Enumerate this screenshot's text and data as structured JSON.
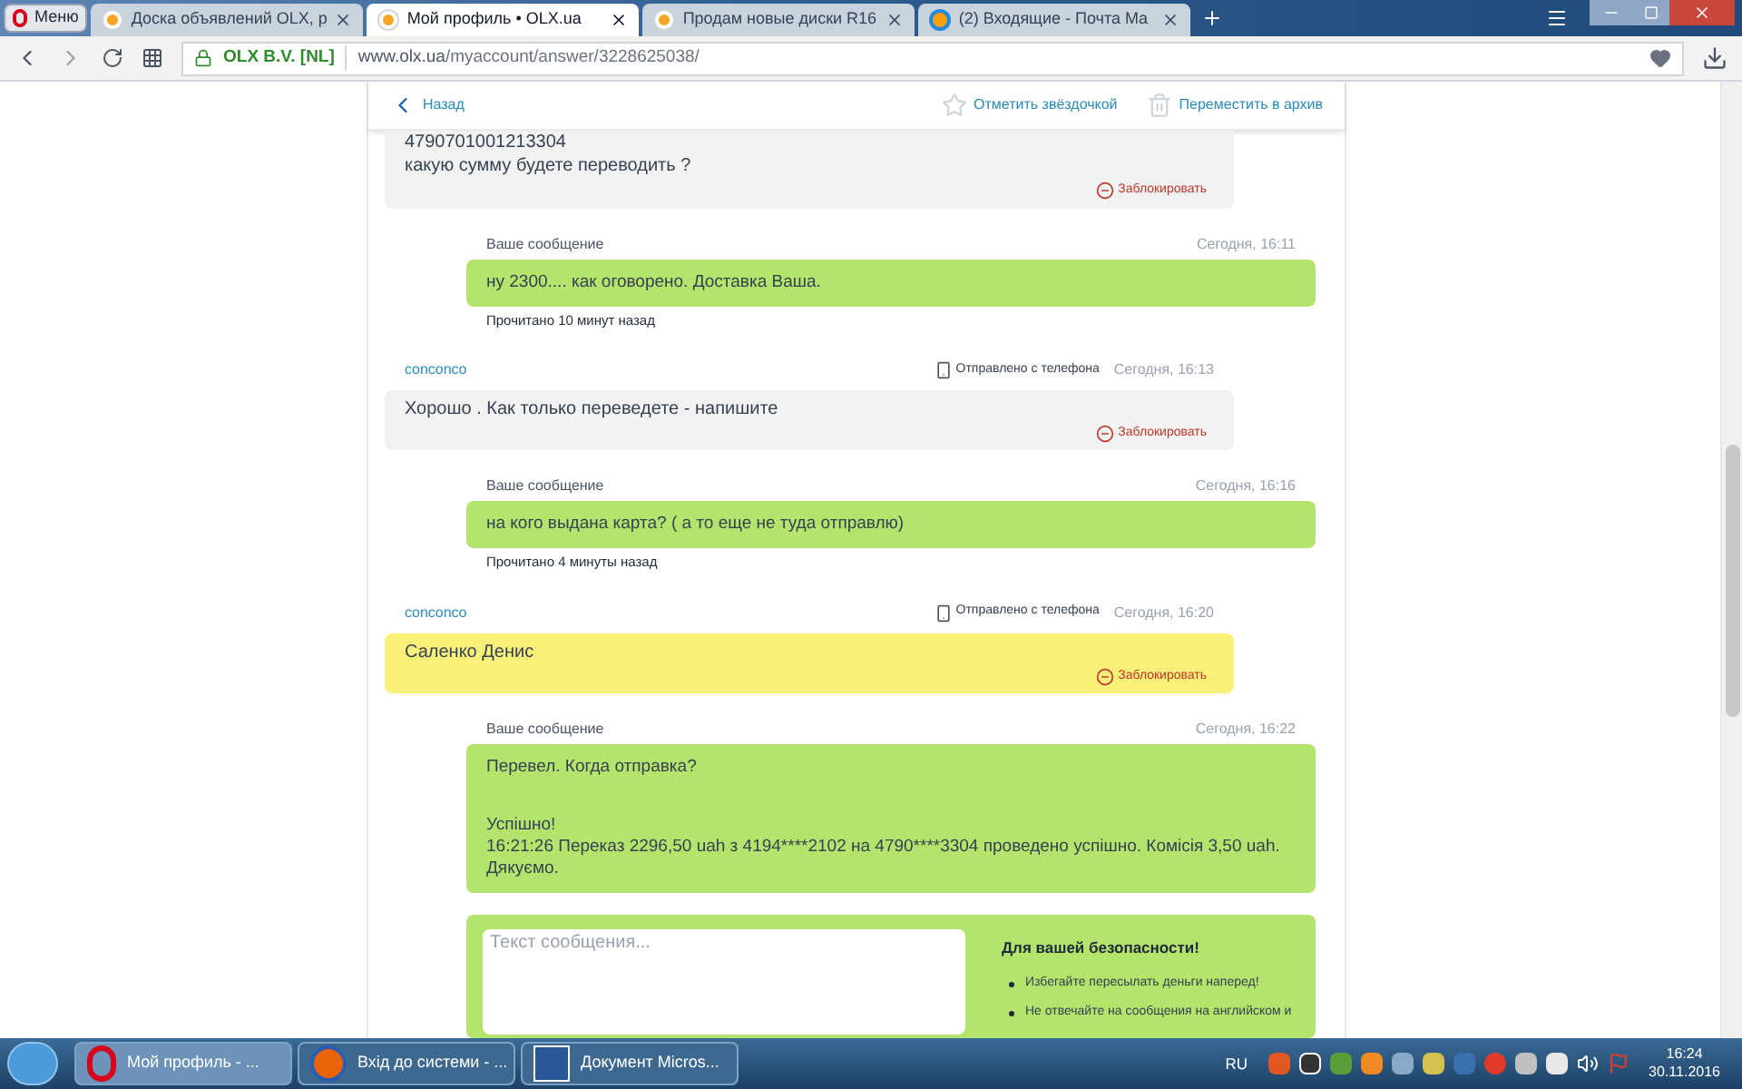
{
  "browser": {
    "menu_label": "Меню",
    "tabs": [
      {
        "title": "Доска объявлений OLX, р",
        "selected": false,
        "kind": "olx"
      },
      {
        "title": "Мой профиль • OLX.ua",
        "selected": true,
        "kind": "olx"
      },
      {
        "title": "Продам новые диски R16",
        "selected": false,
        "kind": "olx"
      },
      {
        "title": "(2) Входящие - Почта Ma",
        "selected": false,
        "kind": "mail"
      }
    ],
    "address": {
      "security": "OLX B.V. [NL]",
      "host": "www.olx.ua",
      "path": "/myaccount/answer/3228625038/"
    }
  },
  "toolbar": {
    "back": "Назад",
    "star": "Отметить звёздочкой",
    "archive": "Переместить в архив"
  },
  "messages": [
    {
      "kind": "incoming",
      "lines": [
        "4790701001213304\nкакую сумму будете переводить ?"
      ],
      "block": "Заблокировать",
      "highlighted": false
    },
    {
      "kind": "outgoing",
      "label": "Ваше сообщение",
      "time": "Сегодня, 16:11",
      "lines": [
        "ну 2300.... как оговорено. Доставка Ваша."
      ],
      "read": "Прочитано 10 минут назад"
    },
    {
      "kind": "incoming",
      "author": "conconco",
      "device": "Отправлено с телефона",
      "time": "Сегодня, 16:13",
      "lines": [
        "Хорошо . Как только переведете - напишите"
      ],
      "block": "Заблокировать",
      "highlighted": false
    },
    {
      "kind": "outgoing",
      "label": "Ваше сообщение",
      "time": "Сегодня, 16:16",
      "lines": [
        "на кого выдана карта? ( а то еще не туда отправлю)"
      ],
      "read": "Прочитано 4 минуты назад"
    },
    {
      "kind": "incoming",
      "author": "conconco",
      "device": "Отправлено с телефона",
      "time": "Сегодня, 16:20",
      "lines": [
        "Саленко Денис"
      ],
      "block": "Заблокировать",
      "highlighted": true
    },
    {
      "kind": "outgoing",
      "label": "Ваше сообщение",
      "time": "Сегодня, 16:22",
      "lines": [
        "Перевел. Когда отправка?",
        "Успішно!\n16:21:26 Переказ 2296,50 uah з 4194****2102 на 4790****3304 проведено успішно. Комісія 3,50 uah.\nДякуємо."
      ]
    }
  ],
  "composer": {
    "placeholder": "Текст сообщения...",
    "safety_title": "Для вашей безопасности!",
    "tips": [
      "Избегайте пересылать деньги наперед!",
      "Не отвечайте на сообщения на английском и"
    ]
  },
  "taskbar": {
    "items": [
      {
        "title": "Мой профиль - ...",
        "kind": "opera",
        "selected": true
      },
      {
        "title": "Вхід до системи - ...",
        "kind": "firefox",
        "selected": false
      },
      {
        "title": "Документ Micros...",
        "kind": "word",
        "selected": false
      }
    ],
    "lang": "RU",
    "time": "16:24",
    "date": "30.11.2016"
  }
}
